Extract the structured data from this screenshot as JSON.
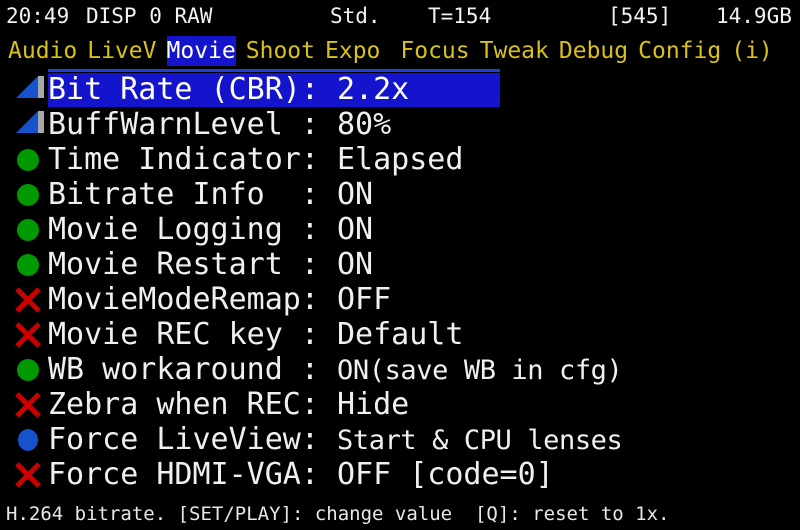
{
  "colors": {
    "background": "#000000",
    "highlight": "#1414cc",
    "tab_text": "#d8c11a",
    "text": "#f0f0f0",
    "icon_on": "#009900",
    "icon_off": "#cc0000",
    "icon_blue": "#1552cc",
    "slider_blue": "#1552cc",
    "slider_gray": "#a8a8a8",
    "underline": "#1f3fdd"
  },
  "statusbar": {
    "clock": "20:49",
    "display_mode": "DISP 0 RAW",
    "picture_style": "Std.",
    "temperature": "T=154",
    "shots_remaining": "[545]",
    "card_space": "14.9GB"
  },
  "tabs": [
    {
      "label": "Audio",
      "selected": false
    },
    {
      "label": "LiveV",
      "selected": false
    },
    {
      "label": "Movie",
      "selected": true
    },
    {
      "label": "Shoot",
      "selected": false
    },
    {
      "label": "Expo",
      "selected": false
    },
    {
      "label": "Focus",
      "selected": false
    },
    {
      "label": "Tweak",
      "selected": false
    },
    {
      "label": "Debug",
      "selected": false
    },
    {
      "label": "Config",
      "selected": false
    },
    {
      "label": "(i)",
      "selected": false
    }
  ],
  "menu_items": [
    {
      "icon": "slider-icon",
      "label": "Bit Rate (CBR):",
      "value": "2.2x",
      "selected": true,
      "small_value": false
    },
    {
      "icon": "slider-icon",
      "label": "BuffWarnLevel :",
      "value": "80%",
      "selected": false,
      "small_value": false
    },
    {
      "icon": "green-dot-icon",
      "label": "Time Indicator:",
      "value": "Elapsed",
      "selected": false,
      "small_value": false
    },
    {
      "icon": "green-dot-icon",
      "label": "Bitrate Info  :",
      "value": "ON",
      "selected": false,
      "small_value": false
    },
    {
      "icon": "green-dot-icon",
      "label": "Movie Logging :",
      "value": "ON",
      "selected": false,
      "small_value": false
    },
    {
      "icon": "green-dot-icon",
      "label": "Movie Restart :",
      "value": "ON",
      "selected": false,
      "small_value": false
    },
    {
      "icon": "red-x-icon",
      "label": "MovieModeRemap:",
      "value": "OFF",
      "selected": false,
      "small_value": false
    },
    {
      "icon": "red-x-icon",
      "label": "Movie REC key :",
      "value": "Default",
      "selected": false,
      "small_value": false
    },
    {
      "icon": "green-dot-icon",
      "label": "WB workaround :",
      "value": "ON(save WB in cfg)",
      "selected": false,
      "small_value": true
    },
    {
      "icon": "red-x-icon",
      "label": "Zebra when REC:",
      "value": "Hide",
      "selected": false,
      "small_value": false
    },
    {
      "icon": "blue-dot-icon",
      "label": "Force LiveView:",
      "value": "Start & CPU lenses",
      "selected": false,
      "small_value": true
    },
    {
      "icon": "red-x-icon",
      "label": "Force HDMI-VGA:",
      "value": "OFF [code=0]",
      "selected": false,
      "small_value": false
    }
  ],
  "helpbar": {
    "text": "H.264 bitrate. [SET/PLAY]: change value  [Q]: reset to 1x."
  }
}
